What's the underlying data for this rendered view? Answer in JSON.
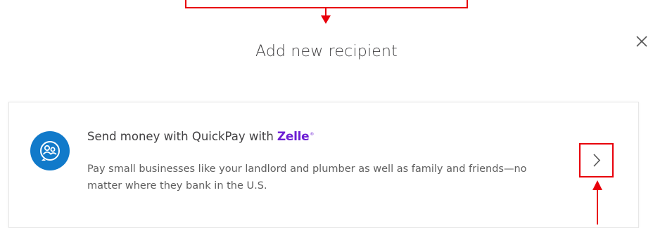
{
  "modal": {
    "title": "Add new recipient"
  },
  "option": {
    "title": "Send money with QuickPay with",
    "brand": "Zelle",
    "brand_mark": "®",
    "description": "Pay small businesses like your landlord and plumber as well as family and friends—no matter where they bank in the U.S.",
    "icon": "quickpay-icon"
  },
  "colors": {
    "accent_blue": "#117aca",
    "zelle_purple": "#6d1ed4",
    "annotation_red": "#e8000b",
    "text": "#414042"
  },
  "icons": {
    "close": "close-icon",
    "chevron": "chevron-right-icon"
  }
}
